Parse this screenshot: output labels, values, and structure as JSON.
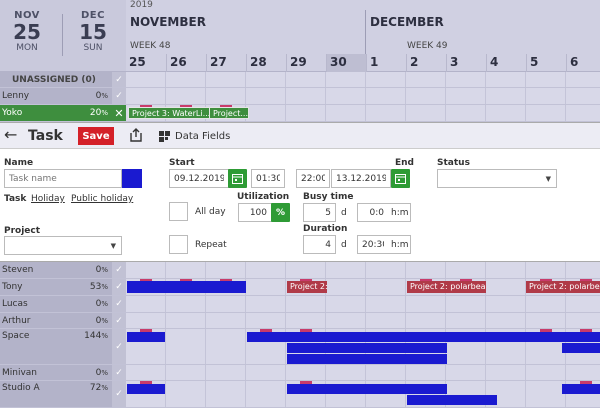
{
  "header": {
    "start": {
      "month": "NOV",
      "day": "25",
      "weekday": "MON"
    },
    "end": {
      "month": "DEC",
      "day": "15",
      "weekday": "SUN"
    },
    "year": "2019",
    "months": [
      "NOVEMBER",
      "DECEMBER"
    ],
    "weeks": [
      "WEEK 48",
      "WEEK 49"
    ],
    "days": [
      "25",
      "26",
      "27",
      "28",
      "29",
      "30",
      "1",
      "2",
      "3",
      "4",
      "5",
      "6"
    ]
  },
  "upper_rows": {
    "unassigned": "UNASSIGNED (0)",
    "lenny": {
      "name": "Lenny",
      "pct": "0",
      "unit": "%"
    },
    "yoko": {
      "name": "Yoko",
      "pct": "20",
      "unit": "%",
      "remove_icon": "✕"
    },
    "yoko_bars": [
      "Project 3: WaterLi...",
      "Project..."
    ]
  },
  "editor": {
    "title": "Task",
    "save_label": "Save",
    "data_fields_label": "Data Fields",
    "name_label": "Name",
    "name_placeholder": "Task name",
    "name_color": "#1a1ad0",
    "types": [
      "Task",
      "Holiday",
      "Public holiday"
    ],
    "start_label": "Start",
    "start_date": "09.12.2019",
    "start_time": "01:30",
    "end_label": "End",
    "end_time": "22:00",
    "end_date": "13.12.2019",
    "status_label": "Status",
    "status_value": "",
    "utilization_label": "Utilization",
    "utilization_value": "100",
    "utilization_unit": "%",
    "allday_label": "All day",
    "busy_label": "Busy time",
    "busy_days": "5",
    "busy_days_unit": "d",
    "busy_time": "0:0",
    "busy_time_unit": "h:m",
    "project_label": "Project",
    "project_value": "",
    "repeat_label": "Repeat",
    "duration_label": "Duration",
    "duration_days": "4",
    "duration_days_unit": "d",
    "duration_time": "20:30",
    "duration_time_unit": "h:m"
  },
  "lower_rows": [
    {
      "name": "Steven",
      "pct": "0",
      "unit": "%"
    },
    {
      "name": "Tony",
      "pct": "53",
      "unit": "%"
    },
    {
      "name": "Lucas",
      "pct": "0",
      "unit": "%"
    },
    {
      "name": "Arthur",
      "pct": "0",
      "unit": "%"
    },
    {
      "name": "Space",
      "pct": "144",
      "unit": "%"
    },
    {
      "name": "Minivan",
      "pct": "0",
      "unit": "%"
    },
    {
      "name": "Studio A",
      "pct": "72",
      "unit": "%"
    }
  ],
  "tony_bars": [
    "Project 2: ...",
    "Project 2: polarbea...",
    "Project 2: polarbea..."
  ],
  "colors": {
    "accent_green": "#2e9b35",
    "save_red": "#d42028",
    "task_blue": "#1a1ad0",
    "project_red": "#b03a48",
    "tick_pink": "#c83a6a"
  }
}
